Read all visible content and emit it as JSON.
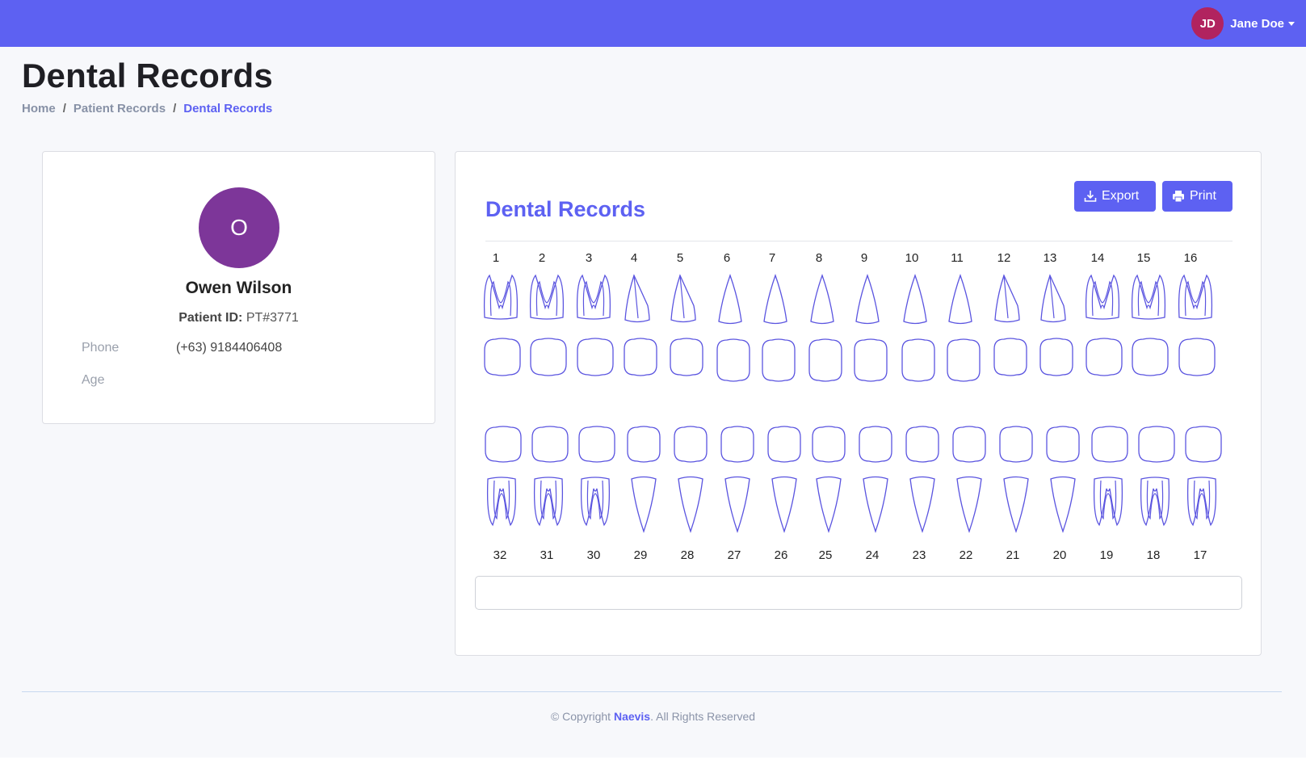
{
  "header": {
    "user_initials": "JD",
    "user_name": "Jane Doe",
    "accent_color": "#5d61f2"
  },
  "page": {
    "title": "Dental Records",
    "breadcrumb": [
      "Home",
      "Patient Records",
      "Dental Records"
    ]
  },
  "patient": {
    "avatar_letter": "O",
    "name": "Owen Wilson",
    "id_label": "Patient ID:",
    "id_value": "PT#3771",
    "phone_label": "Phone",
    "phone_value": "(+63) 9184406408",
    "age_label": "Age",
    "age_value": ""
  },
  "records": {
    "title": "Dental Records",
    "export_label": "Export",
    "print_label": "Print",
    "upper_teeth": [
      "1",
      "2",
      "3",
      "4",
      "5",
      "6",
      "7",
      "8",
      "9",
      "10",
      "11",
      "12",
      "13",
      "14",
      "15",
      "16"
    ],
    "lower_teeth": [
      "32",
      "31",
      "30",
      "29",
      "28",
      "27",
      "26",
      "25",
      "24",
      "23",
      "22",
      "21",
      "20",
      "19",
      "18",
      "17"
    ],
    "note_value": ""
  },
  "footer": {
    "prefix": "© Copyright",
    "brand": "Naevis",
    "suffix": ". All Rights Reserved"
  }
}
